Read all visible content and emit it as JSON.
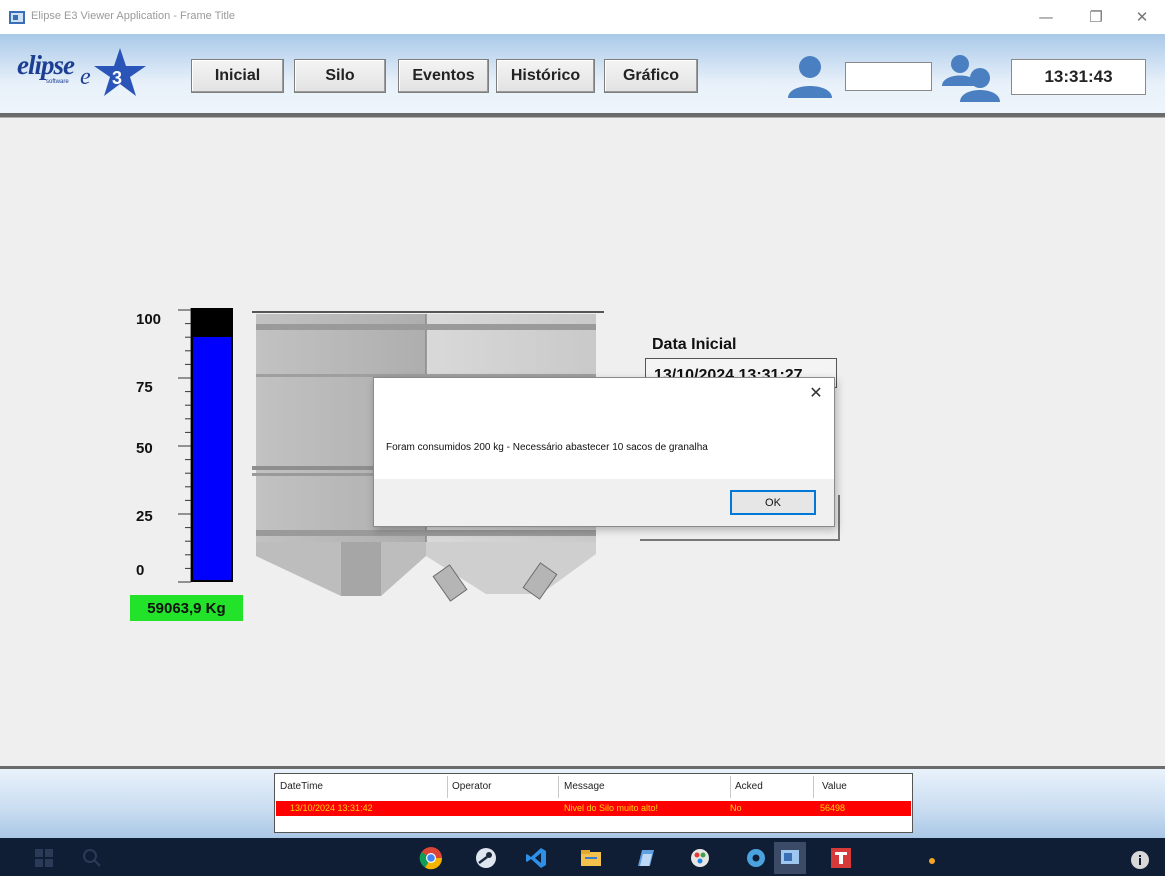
{
  "window": {
    "title": "Elipse E3 Viewer Application - Frame Title",
    "minimize_glyph": "—",
    "restore_glyph": "❐",
    "close_glyph": "✕"
  },
  "header": {
    "logo_text": "elipse",
    "logo_subtext": "software",
    "nav": [
      {
        "label": "Inicial"
      },
      {
        "label": "Silo"
      },
      {
        "label": "Eventos"
      },
      {
        "label": "Histórico"
      },
      {
        "label": "Gráfico"
      }
    ],
    "user_value": "",
    "clock": "13:31:43",
    "accent_color": "#4a7fc1"
  },
  "silo": {
    "scale_ticks": [
      "100",
      "75",
      "50",
      "25",
      "0"
    ],
    "level_percent": 90,
    "weight": "59063,9 Kg",
    "fill_color": "#0000ff"
  },
  "date_panel": {
    "label": "Data Inicial",
    "value": "13/10/2024 13:31:27"
  },
  "dialog": {
    "close_glyph": "✕",
    "message": "Foram consumidos 200 kg - Necessário abastecer 10 sacos de granalha",
    "ok_label": "OK"
  },
  "alarms": {
    "columns": [
      "DateTime",
      "Operator",
      "Message",
      "Acked",
      "Value"
    ],
    "rows": [
      {
        "datetime": "13/10/2024 13:31:42",
        "operator": "",
        "message": "Nivel do Silo muito alto!",
        "acked": "No",
        "value": "56498"
      }
    ],
    "row_color": "#ff0000",
    "text_color": "#ffd400"
  },
  "taskbar": {
    "icons": [
      "windows-start-icon",
      "search-icon",
      "chrome-icon",
      "steam-icon",
      "vscode-icon",
      "file-explorer-icon",
      "notepad-icon",
      "paint-icon",
      "settings-icon",
      "elipse-viewer-icon",
      "tool-icon",
      "info-icon"
    ]
  }
}
